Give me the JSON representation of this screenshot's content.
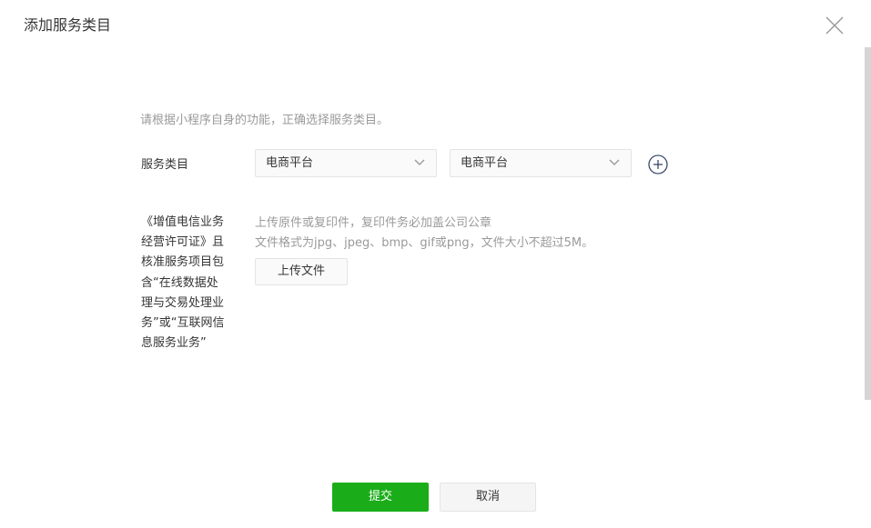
{
  "dialog": {
    "title": "添加服务类目",
    "hint": "请根据小程序自身的功能，正确选择服务类目。"
  },
  "category": {
    "label": "服务类目",
    "primary_value": "电商平台",
    "secondary_value": "电商平台"
  },
  "license": {
    "label": "《增值电信业务经营许可证》且核准服务项目包含“在线数据处理与交易处理业务”或“互联网信息服务业务”",
    "tip_line1": "上传原件或复印件，复印件务必加盖公司公章",
    "tip_line2": "文件格式为jpg、jpeg、bmp、gif或png，文件大小不超过5M。",
    "upload_label": "上传文件"
  },
  "actions": {
    "submit_label": "提交",
    "cancel_label": "取消"
  },
  "icons": {
    "close": "close-icon",
    "chevron": "chevron-down-icon",
    "add": "plus-circle-icon"
  },
  "colors": {
    "primary": "#1aad19",
    "text": "#353535",
    "muted": "#9a9a9a",
    "border": "#e4e4e4"
  }
}
